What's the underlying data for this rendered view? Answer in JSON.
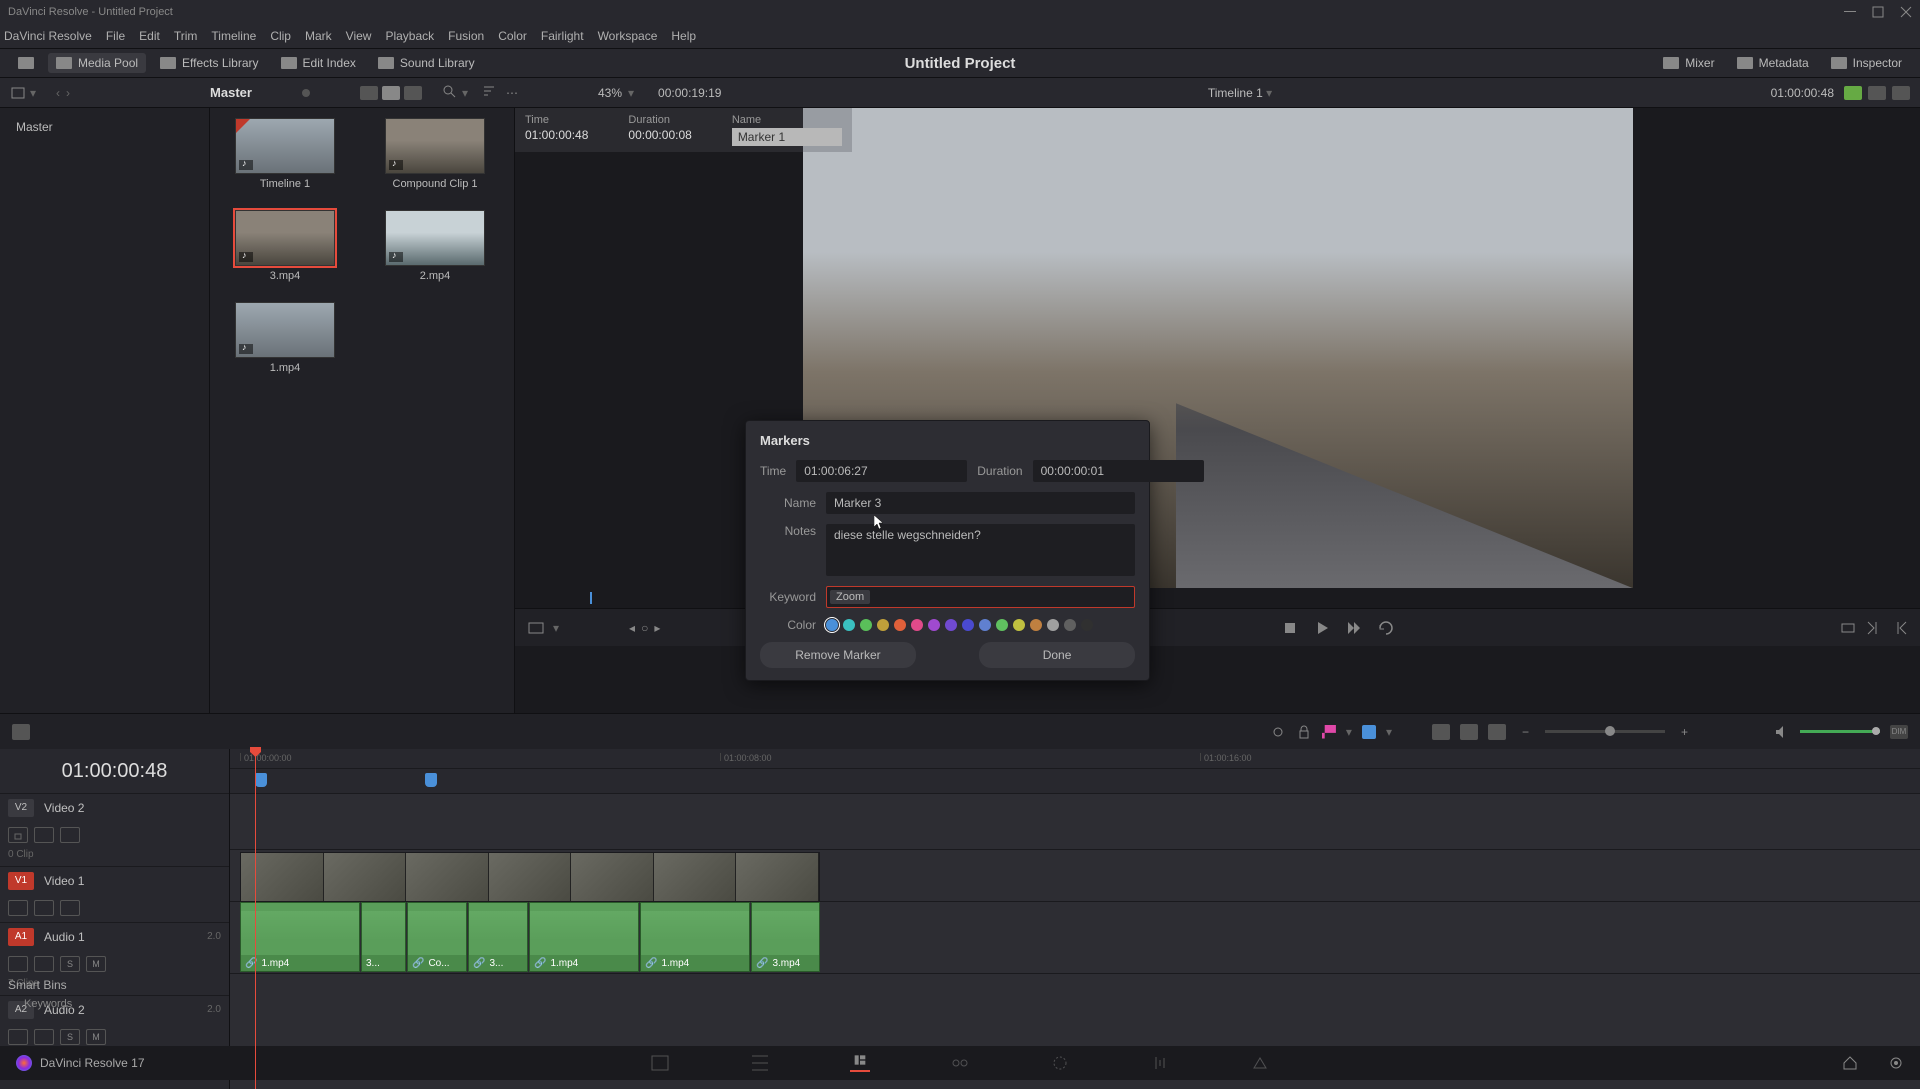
{
  "titlebar": {
    "text": "DaVinci Resolve - Untitled Project"
  },
  "menu": [
    "DaVinci Resolve",
    "File",
    "Edit",
    "Trim",
    "Timeline",
    "Clip",
    "Mark",
    "View",
    "Playback",
    "Fusion",
    "Color",
    "Fairlight",
    "Workspace",
    "Help"
  ],
  "toolbar": {
    "media_pool": "Media Pool",
    "effects_library": "Effects Library",
    "edit_index": "Edit Index",
    "sound_library": "Sound Library",
    "mixer": "Mixer",
    "metadata": "Metadata",
    "inspector": "Inspector"
  },
  "project_title": "Untitled Project",
  "subbar": {
    "master": "Master",
    "zoom": "43%",
    "tc_left": "00:00:19:19",
    "timeline_name": "Timeline 1",
    "tc_right": "01:00:00:48"
  },
  "bins": {
    "master": "Master"
  },
  "clips": [
    {
      "name": "Timeline 1"
    },
    {
      "name": "Compound Clip 1"
    },
    {
      "name": "3.mp4"
    },
    {
      "name": "2.mp4"
    },
    {
      "name": "1.mp4"
    }
  ],
  "viewer_header": {
    "time_label": "Time",
    "time": "01:00:00:48",
    "duration_label": "Duration",
    "duration": "00:00:00:08",
    "name_label": "Name",
    "name": "Marker 1"
  },
  "markers_dialog": {
    "title": "Markers",
    "time_label": "Time",
    "time": "01:00:06:27",
    "duration_label": "Duration",
    "duration": "00:00:00:01",
    "name_label": "Name",
    "name": "Marker 3",
    "notes_label": "Notes",
    "notes": "diese stelle wegschneiden?",
    "keyword_label": "Keyword",
    "keyword_tag": "Zoom",
    "color_label": "Color",
    "colors": [
      "#4a90d9",
      "#3ac0c0",
      "#5ac05a",
      "#c0a03a",
      "#e0603a",
      "#e04a8a",
      "#a04ad0",
      "#704ad0",
      "#4a4ad0",
      "#6080d0",
      "#60c060",
      "#c0c040",
      "#c08040",
      "#a0a0a0",
      "#606060",
      "#303030"
    ],
    "remove": "Remove Marker",
    "done": "Done"
  },
  "timeline": {
    "timecode": "01:00:00:48",
    "ruler_ticks": [
      "01:00:00:00",
      "01:00:08:00",
      "01:00:16:00"
    ],
    "tracks": {
      "v2": {
        "badge": "V2",
        "name": "Video 2",
        "sub": "0 Clip"
      },
      "v1": {
        "badge": "V1",
        "name": "Video 1"
      },
      "a1": {
        "badge": "A1",
        "name": "Audio 1",
        "ch": "2.0",
        "sub": "7 Clips"
      },
      "a2": {
        "badge": "A2",
        "name": "Audio 2",
        "ch": "2.0"
      }
    },
    "audio_clips": [
      "1.mp4",
      "3...",
      "Co...",
      "3...",
      "1.mp4",
      "1.mp4",
      "3.mp4"
    ],
    "solo": "S",
    "mute": "M"
  },
  "smart_bins": {
    "header": "Smart Bins",
    "keywords": "Keywords"
  },
  "bottom": {
    "app": "DaVinci Resolve 17"
  }
}
